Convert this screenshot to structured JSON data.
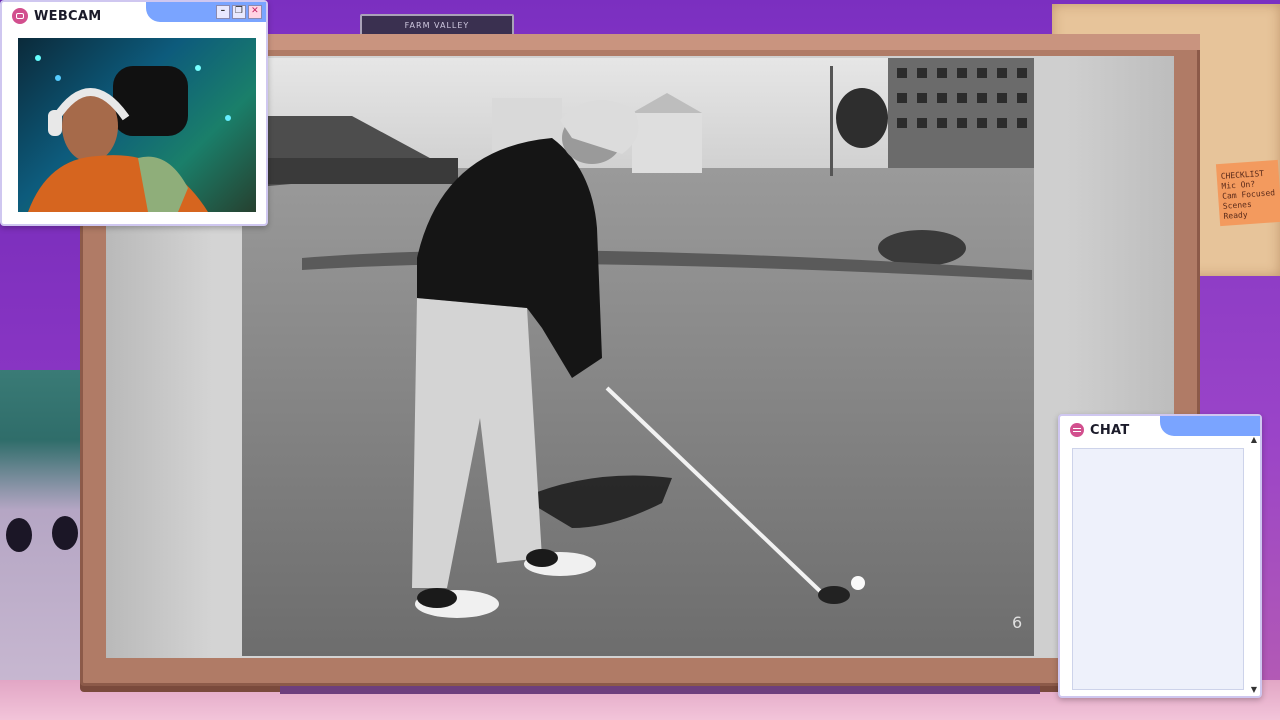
{
  "overlays": {
    "webcam": {
      "title": "WEBCAM",
      "icon": "camera-icon",
      "buttons": {
        "minimize": "–",
        "restore": "❐",
        "close": "✕"
      }
    },
    "chat": {
      "title": "CHAT",
      "icon": "chat-bubble-icon",
      "scroll": {
        "up": "▲",
        "down": "▼"
      }
    }
  },
  "scene": {
    "top_shelf_label": "FARM VALLEY",
    "sticky_note": {
      "lines": [
        "CHECKLIST",
        "Mic On?",
        "Cam Focused",
        "Scenes Ready"
      ]
    }
  },
  "photo": {
    "corner_number": "6"
  },
  "colors": {
    "accent_pink": "#d24f8e",
    "tab_blue": "#7aa4ff",
    "monitor_frame": "#b07b66",
    "wall_purple": "#7b2fc0"
  }
}
